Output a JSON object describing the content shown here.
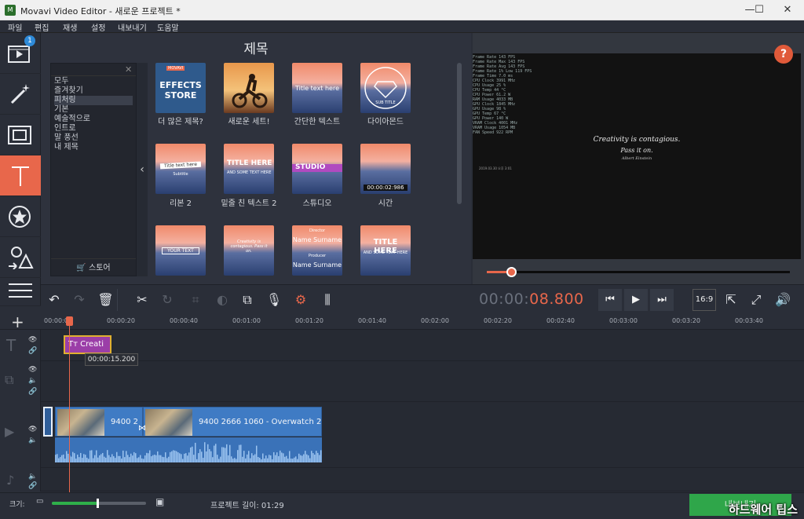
{
  "window": {
    "title": "Movavi Video Editor - 새로운 프로젝트 *",
    "app_icon": "M",
    "min": "—",
    "max": "☐",
    "close": "✕"
  },
  "menu": [
    "파일",
    "편집",
    "재생",
    "설정",
    "내보내기",
    "도움말"
  ],
  "sidebar": {
    "badge": "1",
    "active": "titles"
  },
  "panel": {
    "title": "제목",
    "categories": [
      "모두",
      "즐겨찾기",
      "피처링",
      "기본",
      "예술적으로",
      "인트로",
      "말 풍선",
      "내 제목"
    ],
    "selected_category": "피처링",
    "store_label": "스토어",
    "tiles": [
      {
        "label": "더 많은 제목?",
        "art": "EFFECTS STORE",
        "art_top": "MOVAVI"
      },
      {
        "label": "새로운 세트!"
      },
      {
        "label": "간단한 텍스트",
        "art": "Title text here"
      },
      {
        "label": "다이아몬드",
        "art": "SUB TITLE"
      },
      {
        "label": "리본 2",
        "art": "Title text here",
        "art_sub": "Subtitle"
      },
      {
        "label": "밑줄 친 텍스트 2",
        "art": "TITLE HERE",
        "art_sub": "AND SOME TEXT HERE"
      },
      {
        "label": "스튜디오",
        "art": "STUDIO"
      },
      {
        "label": "시간",
        "art": "00:00:02:986"
      },
      {
        "art": "YOUR TEXT"
      },
      {
        "art": "Creativity is contagious. Pass it on."
      },
      {
        "art": "Name Surname",
        "art_top": "Director",
        "art_sub": "Name Surname",
        "art_mid": "Producer"
      },
      {
        "art": "TITLE HERE",
        "art_sub": "AND SOME TEXT HERE"
      }
    ]
  },
  "preview": {
    "help": "?",
    "quote_line1": "Creativity is contagious.",
    "quote_line2": "Pass it on.",
    "quote_author": "Albert Einstein",
    "osd": [
      "Frame Rate    143 FPS",
      "Frame Rate Max  143 FPS",
      "Frame Rate Avg  143 FPS",
      "Frame Rate 1% Low 119 FPS",
      "Frame Time   7.0 ms",
      "CPU Clock    3991 MHz",
      "CPU Usage    25 %",
      "CPU Temp     44 °C",
      "CPU Power    61.2 W",
      "RAM Usage    4033 MB",
      "GPU Clock    1845 MHz",
      "GPU Usage    98 %",
      "GPU Temp     67 °C",
      "GPU Power    140 W",
      "VRAM Clock   4001 MHz",
      "VRAM Usage   1054 MB",
      "FAN Speed    922 RPM"
    ],
    "osd_small": "2019.03.30 오후 3:01",
    "progress": 0.08
  },
  "timecode": {
    "grey": "00:00:",
    "red": "08.800"
  },
  "aspect": "16:9",
  "ruler": [
    "00:00:00",
    "00:00:20",
    "00:00:40",
    "00:01:00",
    "00:01:20",
    "00:01:40",
    "00:02:00",
    "00:02:20",
    "00:02:40",
    "00:03:00",
    "00:03:20",
    "00:03:40"
  ],
  "timeline": {
    "title_clip": "Creati",
    "tooltip": "00:00:15.200",
    "clip1": "9400 2",
    "clip2": "9400 2666 1060 - Overwatch 2"
  },
  "footer": {
    "zoom_label": "크기:",
    "zoom": 0.48,
    "project_length": "프로젝트 길이:  01:29",
    "export": "내보내기"
  },
  "watermark": "하드웨어 팁스"
}
